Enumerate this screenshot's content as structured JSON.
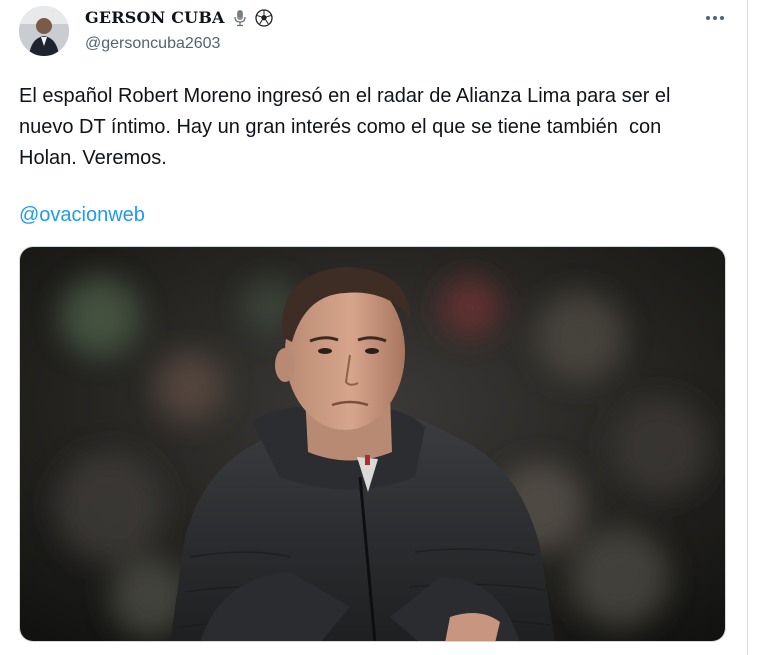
{
  "author": {
    "name": "GERSON CUBA",
    "handle": "@gersoncuba2603",
    "name_icons": [
      "microphone-icon",
      "soccer-ball-icon"
    ]
  },
  "tweet": {
    "text": "El español Robert Moreno ingresó en el radar de Alianza Lima para ser el\nnuevo DT íntimo. Hay un gran interés como el que se tiene también  con\nHolan. Veremos.",
    "mention": "@ovacionweb"
  },
  "icons": {
    "more": "more-options-icon",
    "avatar": "avatar"
  },
  "colors": {
    "text": "#0f1419",
    "secondary": "#536471",
    "link": "#1d9bf0"
  }
}
